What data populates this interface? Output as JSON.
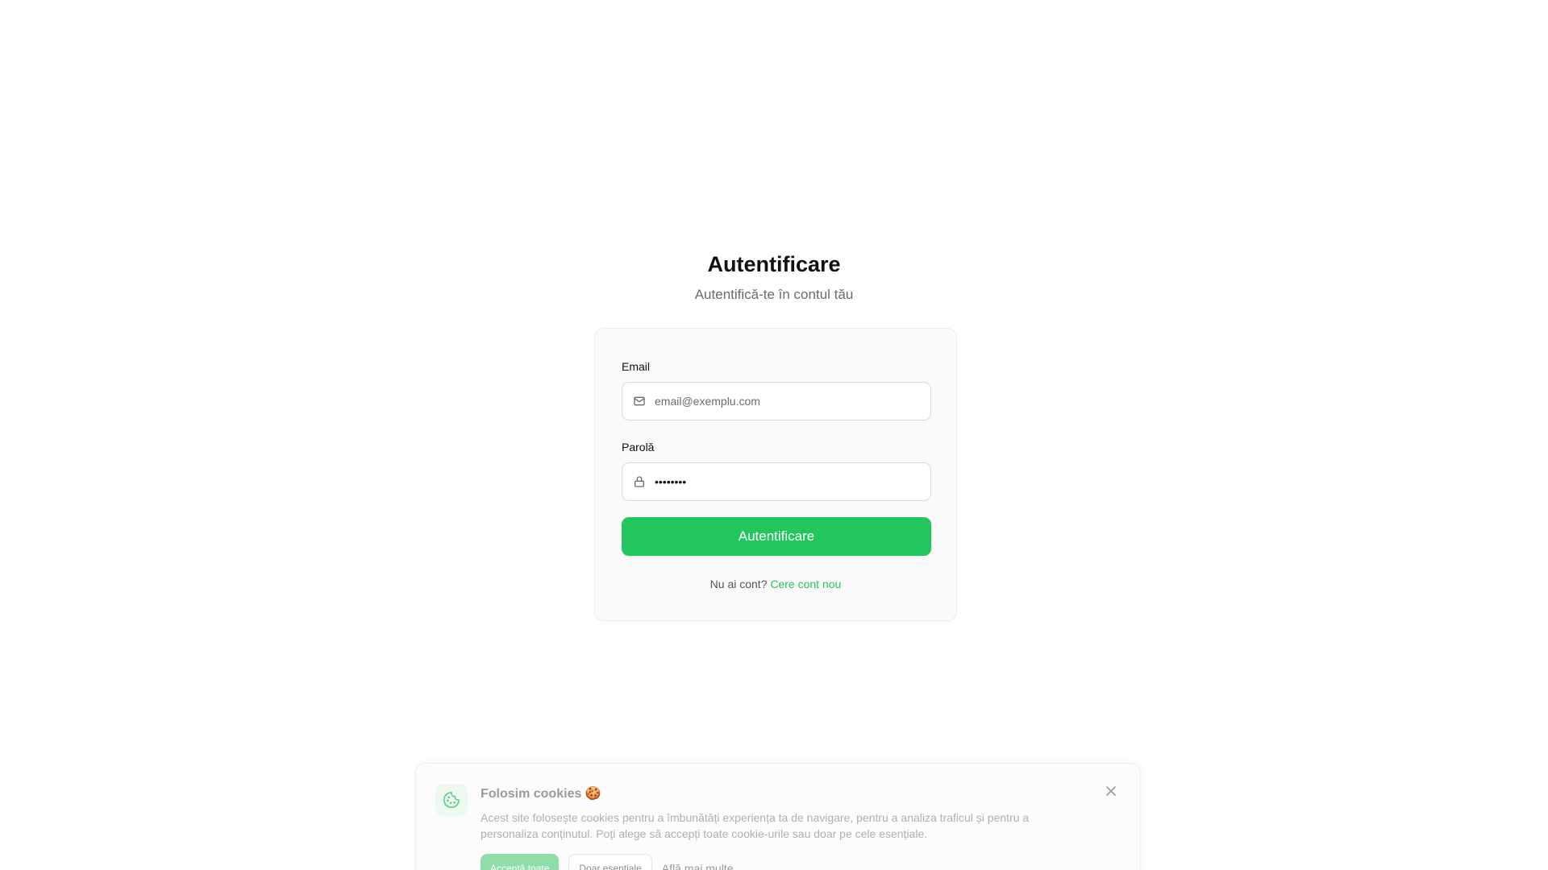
{
  "header": {
    "title": "Autentificare",
    "subtitle": "Autentifică-te în contul tău"
  },
  "form": {
    "email_label": "Email",
    "email_placeholder": "email@exemplu.com",
    "email_icon": "mail-icon",
    "password_label": "Parolă",
    "password_value": "••••••••",
    "password_icon": "lock-icon",
    "submit_label": "Autentificare",
    "signup_prompt": "Nu ai cont?",
    "signup_link": "Cere cont nou"
  },
  "cookie_banner": {
    "title": "Folosim cookies 🍪",
    "icon": "cookie-icon",
    "text": "Acest site folosește cookies pentru a îmbunătăți experiența ta de navigare, pentru a analiza traficul și pentru a personaliza conținutul. Poți alege să accepți toate cookie-urile sau doar pe cele esențiale.",
    "accept_label": "Acceptă toate",
    "essential_label": "Doar esențiale",
    "learn_more_label": "Află mai multe"
  },
  "colors": {
    "accent": "#22c55e",
    "text": "#111111",
    "muted": "#6b6b6b"
  }
}
